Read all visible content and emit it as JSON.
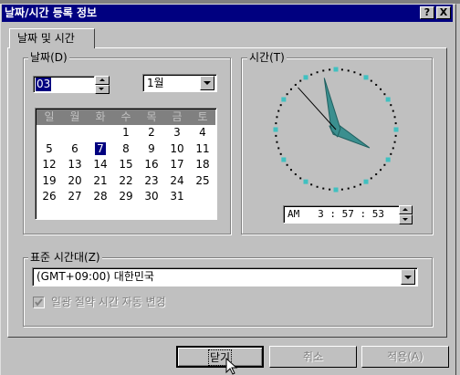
{
  "window": {
    "title": "날짜/시간 등록 정보",
    "help_label": "?",
    "close_label": "X"
  },
  "tab": {
    "label": "날짜 및 시간"
  },
  "date_group": {
    "label": "날짜(D)",
    "year_value": "03",
    "month_value": "1월",
    "weekdays": [
      "일",
      "월",
      "화",
      "수",
      "목",
      "금",
      "토"
    ],
    "weeks": [
      [
        "",
        "",
        "",
        "1",
        "2",
        "3",
        "4"
      ],
      [
        "5",
        "6",
        "7",
        "8",
        "9",
        "10",
        "11"
      ],
      [
        "12",
        "13",
        "14",
        "15",
        "16",
        "17",
        "18"
      ],
      [
        "19",
        "20",
        "21",
        "22",
        "23",
        "24",
        "25"
      ],
      [
        "26",
        "27",
        "28",
        "29",
        "30",
        "31",
        ""
      ]
    ],
    "selected_day": "7"
  },
  "time_group": {
    "label": "시간(T)",
    "time_value": "AM   3 : 57 : 53",
    "clock": {
      "hour": 3,
      "minute": 57,
      "second": 53
    }
  },
  "timezone_group": {
    "label": "표준 시간대(Z)",
    "selected": "(GMT+09:00) 대한민국",
    "dst_label": "일광 절약 시간 자동 변경",
    "dst_checked": true
  },
  "buttons": {
    "close": "닫기",
    "cancel": "취소",
    "apply": "적용(A)"
  },
  "colors": {
    "title_bar": "#000080",
    "face": "#c0c0c0",
    "clock_hand": "#3b8f8f",
    "clock_tick": "#40c0c0"
  }
}
